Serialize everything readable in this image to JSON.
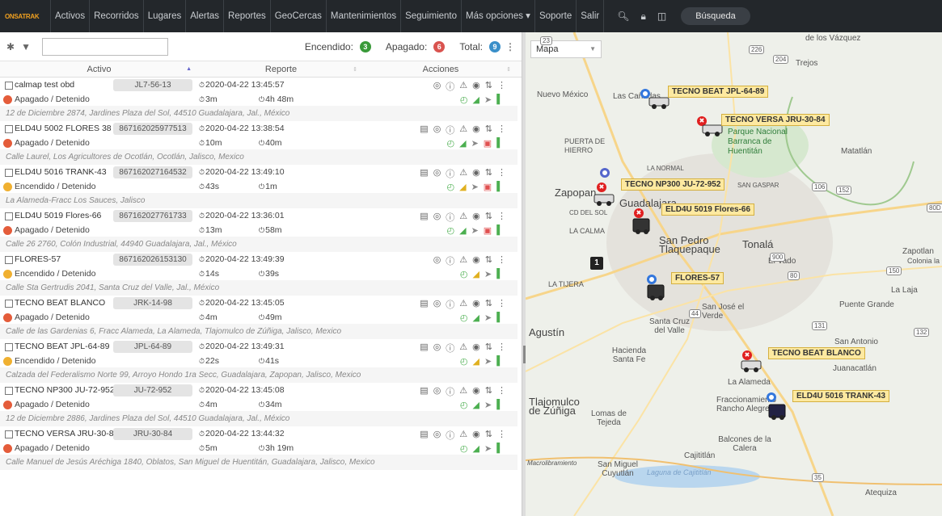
{
  "nav": {
    "logo_text": "ONSATRAK",
    "items": [
      "Activos",
      "Recorridos",
      "Lugares",
      "Alertas",
      "Reportes",
      "GeoCercas",
      "Mantenimientos",
      "Seguimiento",
      "Más opciones ▾",
      "Soporte",
      "Salir"
    ],
    "search_label": "Búsqueda"
  },
  "toolbar": {
    "filter_value": "",
    "encendido_label": "Encendido:",
    "encendido_count": "3",
    "apagado_label": "Apagado:",
    "apagado_count": "6",
    "total_label": "Total:",
    "total_count": "9"
  },
  "table": {
    "headers": [
      "Activo",
      "Reporte",
      "Acciones"
    ]
  },
  "vehicles": [
    {
      "name": "calmap test obd",
      "plate": "JL7-56-13",
      "status": "Apagado / Detenido",
      "state": "off",
      "time": "2020-04-22 13:45:57",
      "dur1": "3m",
      "dur2": "4h 48m",
      "address": "12 de Diciembre 2874, Jardines Plaza del Sol, 44510 Guadalajara, Jal., México"
    },
    {
      "name": "ELD4U 5002 FLORES 38",
      "plate": "867162025977513",
      "status": "Apagado / Detenido",
      "state": "off",
      "time": "2020-04-22 13:38:54",
      "dur1": "10m",
      "dur2": "40m",
      "address": "Calle Laurel, Los Agricultores de Ocotlán, Ocotlán, Jalisco, Mexico"
    },
    {
      "name": "ELD4U 5016 TRANK-43",
      "plate": "867162027164532",
      "status": "Encendido / Detenido",
      "state": "on",
      "time": "2020-04-22 13:49:10",
      "dur1": "43s",
      "dur2": "1m",
      "address": "La Alameda-Fracc Los Sauces, Jalisco"
    },
    {
      "name": "ELD4U 5019 Flores-66",
      "plate": "867162027761733",
      "status": "Apagado / Detenido",
      "state": "off",
      "time": "2020-04-22 13:36:01",
      "dur1": "13m",
      "dur2": "58m",
      "address": "Calle 26 2760, Colón Industrial, 44940 Guadalajara, Jal., México"
    },
    {
      "name": "FLORES-57",
      "plate": "867162026153130",
      "status": "Encendido / Detenido",
      "state": "on",
      "time": "2020-04-22 13:49:39",
      "dur1": "14s",
      "dur2": "39s",
      "address": "Calle Sta Gertrudis 2041, Santa Cruz del Valle, Jal., México"
    },
    {
      "name": "TECNO BEAT BLANCO",
      "plate": "JRK-14-98",
      "status": "Apagado / Detenido",
      "state": "off",
      "time": "2020-04-22 13:45:05",
      "dur1": "4m",
      "dur2": "49m",
      "address": "Calle de las Gardenias 6, Fracc Alameda, La Alameda, Tlajomulco de Zúñiga, Jalisco, Mexico"
    },
    {
      "name": "TECNO BEAT JPL-64-89",
      "plate": "JPL-64-89",
      "status": "Encendido / Detenido",
      "state": "on",
      "time": "2020-04-22 13:49:31",
      "dur1": "22s",
      "dur2": "41s",
      "address": "Calzada del Federalismo Norte 99, Arroyo Hondo 1ra Secc, Guadalajara, Zapopan, Jalisco, Mexico"
    },
    {
      "name": "TECNO NP300 JU-72-952",
      "plate": "JU-72-952",
      "status": "Apagado / Detenido",
      "state": "off",
      "time": "2020-04-22 13:45:08",
      "dur1": "4m",
      "dur2": "34m",
      "address": "12 de Diciembre 2886, Jardines Plaza del Sol, 44510 Guadalajara, Jal., México"
    },
    {
      "name": "TECNO VERSA JRU-30-84",
      "plate": "JRU-30-84",
      "status": "Apagado / Detenido",
      "state": "off",
      "time": "2020-04-22 13:44:32",
      "dur1": "5m",
      "dur2": "3h 19m",
      "address": "Calle Manuel de Jesús Aréchiga 1840, Oblatos, San Miguel de Huentitán, Guadalajara, Jalisco, Mexico"
    }
  ],
  "map": {
    "type_select": "Mapa",
    "place_labels": [
      "Las Cañadas",
      "Nuevo México",
      "PUERTA DE HIERRO",
      "Parque Nacional Barranca de Huentitán",
      "LA NORMAL",
      "Matatlán",
      "Zapopan",
      "Guadalajara",
      "CD DEL SOL",
      "SAN GASPAR",
      "LA CALMA",
      "San Pedro Tlaquepaque",
      "Tonalá",
      "LA TIJERA",
      "El Vado",
      "Zapotlan",
      "Colonia la Cruz",
      "La Laja",
      "San José el Verde",
      "Santa Cruz del Valle",
      "Puente Grande",
      "Agustín",
      "Hacienda Santa Fe",
      "San Antonio",
      "Juanacatlán",
      "La Alameda",
      "Tlajomulco de Zúñiga",
      "Lomas de Tejeda",
      "Fraccionamiento Rancho Alegre",
      "Balcones de la Calera",
      "Cajititlán",
      "San Miguel Cuyutlán",
      "Laguna de Cajititlán",
      "Atequiza",
      "Trejos",
      "de los Vázquez",
      "Macrolibramiento"
    ],
    "vehicle_labels": [
      "TECNO BEAT JPL-64-89",
      "TECNO VERSA JRU-30-84",
      "TECNO NP300 JU-72-952",
      "ELD4U 5019 Flores-66",
      "FLORES-57",
      "TECNO BEAT BLANCO",
      "ELD4U 5016 TRANK-43"
    ],
    "cluster_count": "1",
    "road_badges": [
      "226",
      "204",
      "106",
      "152",
      "80D",
      "80",
      "150",
      "131",
      "132",
      "35",
      "900",
      "44",
      "23"
    ]
  }
}
